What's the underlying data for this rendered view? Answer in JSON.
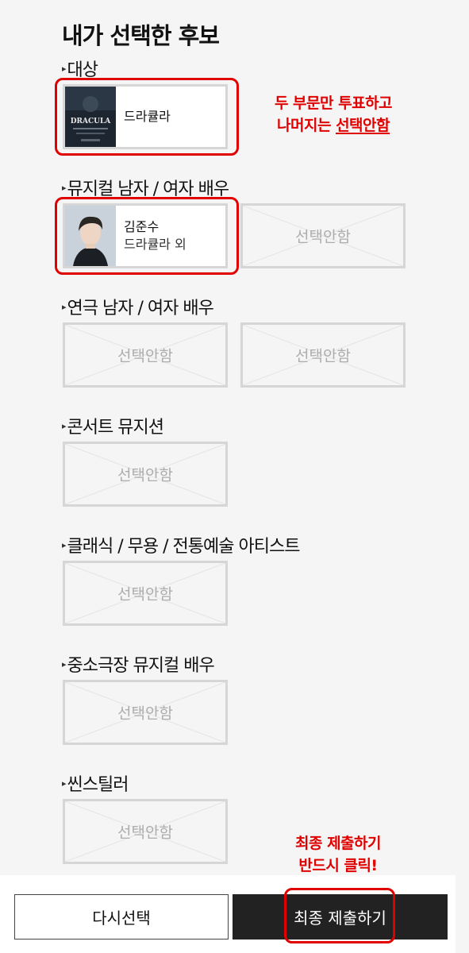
{
  "title": "내가 선택한 후보",
  "empty_label": "선택안함",
  "sections": [
    {
      "title": "대상",
      "cards": [
        {
          "filled": true,
          "name": "드라큘라",
          "sub": "",
          "thumb": "poster",
          "poster_text": "DRACULA"
        }
      ]
    },
    {
      "title": "뮤지컬 남자 / 여자 배우",
      "cards": [
        {
          "filled": true,
          "name": "김준수",
          "sub": "드라큘라 외",
          "thumb": "portrait"
        },
        {
          "filled": false
        }
      ]
    },
    {
      "title": "연극 남자 / 여자 배우",
      "cards": [
        {
          "filled": false
        },
        {
          "filled": false
        }
      ]
    },
    {
      "title": "콘서트 뮤지션",
      "cards": [
        {
          "filled": false
        }
      ]
    },
    {
      "title": "클래식 / 무용 / 전통예술 아티스트",
      "cards": [
        {
          "filled": false
        }
      ]
    },
    {
      "title": "중소극장 뮤지컬 배우",
      "cards": [
        {
          "filled": false
        }
      ]
    },
    {
      "title": "씬스틸러",
      "cards": [
        {
          "filled": false
        }
      ]
    }
  ],
  "annotations": {
    "note_top": {
      "line1": "두 부문만 투표하고",
      "line2_prefix": "나머지는 ",
      "line2_emph": "선택안함"
    },
    "note_bottom": {
      "line1": "최종 제출하기",
      "line2": "반드시 클릭!"
    }
  },
  "buttons": {
    "reset_label": "다시선택",
    "submit_label": "최종 제출하기"
  },
  "colors": {
    "accent_red": "#e00000",
    "submit_bg": "#222222",
    "placeholder_border": "#d6d6d6",
    "placeholder_text": "#adadad"
  },
  "icons": {
    "section_marker": "arrow-icon",
    "empty_card": "placeholder-x-icon"
  }
}
